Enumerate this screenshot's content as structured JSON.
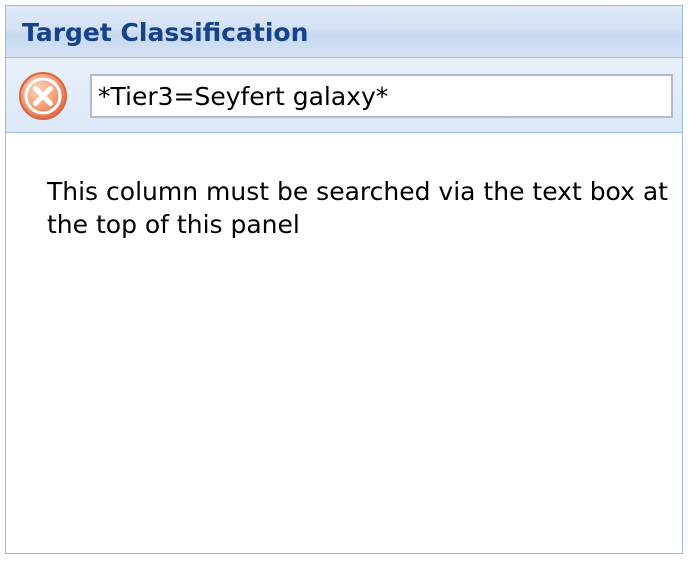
{
  "panel": {
    "title": "Target Classification"
  },
  "toolbar": {
    "clear_icon": "clear-x-circle-icon",
    "clear_icon_color": "#e8734a",
    "search_value": "*Tier3=Seyfert galaxy*"
  },
  "body": {
    "message": "This column must be searched via the text box at the top of this panel"
  },
  "colors": {
    "title": "#15428b",
    "border": "#99bbe8",
    "header_bg": "#d3e1f4"
  }
}
